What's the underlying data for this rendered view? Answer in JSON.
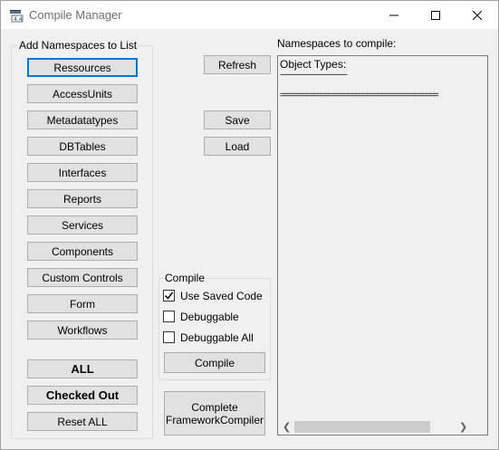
{
  "window": {
    "title": "Compile Manager",
    "icon": "app-window-icon"
  },
  "left_group": {
    "legend": "Add Namespaces to List",
    "buttons": [
      "Ressources",
      "AccessUnits",
      "Metadatatypes",
      "DBTables",
      "Interfaces",
      "Reports",
      "Services",
      "Components",
      "Custom Controls",
      "Form",
      "Workflows"
    ],
    "all_label": "ALL",
    "checked_out_label": "Checked Out",
    "reset_all_label": "Reset ALL"
  },
  "actions": {
    "refresh": "Refresh",
    "save": "Save",
    "load": "Load"
  },
  "compile_group": {
    "legend": "Compile",
    "use_saved_code": {
      "label": "Use Saved Code",
      "checked": true
    },
    "debuggable": {
      "label": "Debuggable",
      "checked": false
    },
    "debuggable_all": {
      "label": "Debuggable All",
      "checked": false
    },
    "compile_button": "Compile"
  },
  "complete_button": {
    "line1": "Complete",
    "line2": "FrameworkCompiler"
  },
  "namespaces": {
    "label": "Namespaces to compile:",
    "lines": [
      "Object Types:",
      "-------------------------------------",
      "",
      "=========================================="
    ]
  }
}
